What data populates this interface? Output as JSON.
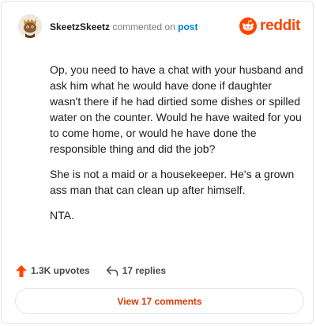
{
  "header": {
    "username": "SkeetzSkeetz",
    "action": "commented on",
    "target": "post",
    "brand": "reddit"
  },
  "comment": {
    "paragraphs": [
      "Op, you need to have a chat with your husband and ask him what he would have done if daughter wasn't there if he had dirtied some dishes or spilled water on the counter. Would he have waited for you to come home, or would he have done the responsible thing and did the job?",
      "She is not a maid or a housekeeper. He's a grown ass man that can clean up after himself.",
      "NTA."
    ]
  },
  "stats": {
    "upvotes": "1.3K upvotes",
    "replies": "17 replies"
  },
  "footer": {
    "view_comments": "View 17 comments"
  },
  "colors": {
    "brand": "#ff4500",
    "link": "#0079d3",
    "upvote": "#ff4500",
    "view_button_text": "#d93a00"
  },
  "icons": {
    "avatar": "snoo-avatar",
    "brand": "reddit-logo-icon",
    "upvote": "upvote-arrow-icon",
    "reply": "reply-arrow-icon"
  }
}
